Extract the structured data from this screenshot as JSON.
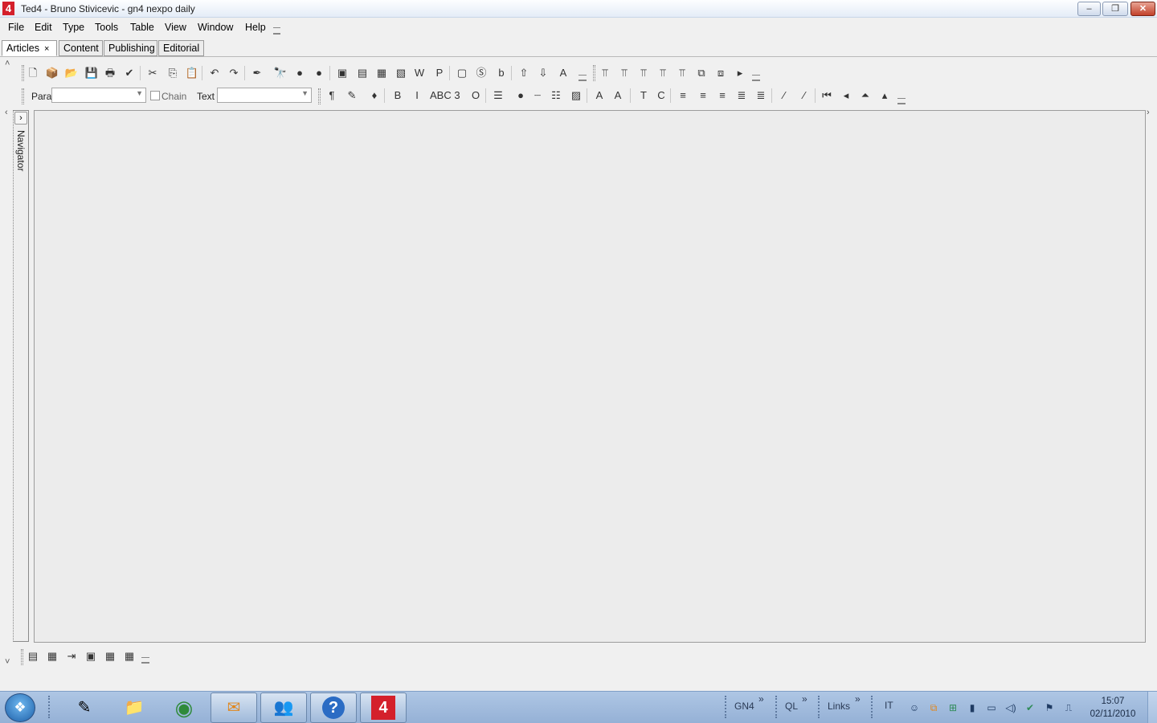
{
  "window": {
    "app_icon": "4",
    "title": "Ted4 - Bruno Stivicevic - gn4 nexpo daily",
    "minimize": "–",
    "restore": "❐",
    "close": "✕"
  },
  "menu": [
    "File",
    "Edit",
    "Type",
    "Tools",
    "Table",
    "View",
    "Window",
    "Help"
  ],
  "tabs": [
    {
      "label": "Articles",
      "closable": true,
      "close_glyph": "×"
    },
    {
      "label": "Content"
    },
    {
      "label": "Publishing"
    },
    {
      "label": "Editorial"
    }
  ],
  "toolbar_top": {
    "icons": [
      "new-icon",
      "package-icon",
      "open-icon",
      "save-icon",
      "print-icon",
      "spellcheck-icon",
      "cut-icon",
      "copy-icon",
      "paste-icon",
      "undo-icon",
      "redo-icon",
      "tools-icon",
      "find-icon",
      "globe-icon",
      "globe-refresh-icon",
      "frame-icon",
      "lock-frame-icon",
      "frames-icon",
      "frames-edit-icon",
      "word-icon",
      "p-icon",
      "folder-icon",
      "export-icon",
      "blog-icon",
      "link-up-icon",
      "link-down-icon",
      "text-format-icon"
    ],
    "glyphs": [
      "🗋",
      "📦",
      "📂",
      "💾",
      "🖶",
      "✔",
      "✂",
      "⎘",
      "📋",
      "↶",
      "↷",
      "✒",
      "🔭",
      "●",
      "●",
      "▣",
      "▤",
      "▦",
      "▧",
      "W",
      "P",
      "▢",
      "Ⓢ",
      "b",
      "⇧",
      "⇩",
      "A"
    ]
  },
  "toolbar_table": {
    "icons": [
      "table-row-above-icon",
      "table-row-below-icon",
      "table-col-left-icon",
      "table-col-right-icon",
      "table-delete-icon",
      "table-merge-icon",
      "table-split-icon",
      "more-arrow-icon"
    ],
    "glyphs": [
      "⫪",
      "⫪",
      "⫪",
      "⫪",
      "⫪",
      "⧉",
      "⧈",
      "▸"
    ]
  },
  "toolbar_format": {
    "para_label": "Para",
    "para_value": "",
    "chain_label": "Chain",
    "text_label": "Text",
    "text_value": "",
    "icons": [
      "pilcrow-icon",
      "brush-icon",
      "ink-icon",
      "bold-icon",
      "italic-icon",
      "strikethrough-icon",
      "number-icon",
      "circle-icon",
      "bullet-list-icon",
      "dot-icon",
      "line-icon",
      "numbered-list-icon",
      "doc-copy-icon",
      "font-grow-icon",
      "font-shrink-icon",
      "text-t-icon",
      "text-c-icon",
      "align-left-icon",
      "align-right-icon",
      "align-center-icon",
      "align-justify-icon",
      "justify-all-icon",
      "wand-icon",
      "wand2-icon",
      "first-icon",
      "prev-icon",
      "top-icon",
      "up-icon"
    ],
    "glyphs": [
      "¶",
      "✎",
      "♦",
      "B",
      "I",
      "ABC",
      "3",
      "O",
      "☰",
      "●",
      "┈",
      "☷",
      "▨",
      "A",
      "A",
      "T",
      "C",
      "≡",
      "≡",
      "≡",
      "≣",
      "≣",
      "⁄",
      "⁄",
      "⏮",
      "◂",
      "⏶",
      "▴"
    ]
  },
  "navigator": {
    "label": "Navigator",
    "toggle": "›"
  },
  "editor": {
    "content": ""
  },
  "bottom_toolbar": {
    "icons": [
      "view-list-icon",
      "view-table-icon",
      "indent-icon",
      "calendar-icon",
      "grid-icon",
      "table-icon"
    ],
    "glyphs": [
      "▤",
      "▦",
      "⇥",
      "▣",
      "▦",
      "▦"
    ]
  },
  "taskbar": {
    "start_glyph": "❖",
    "buttons": [
      {
        "name": "taskbar-notes",
        "glyph": "✎",
        "running": false
      },
      {
        "name": "taskbar-explorer",
        "glyph": "📁",
        "running": false
      },
      {
        "name": "taskbar-chrome",
        "glyph": "◉",
        "running": false
      },
      {
        "name": "taskbar-outlook",
        "glyph": "✉",
        "running": true
      },
      {
        "name": "taskbar-messenger",
        "glyph": "👥",
        "running": true
      },
      {
        "name": "taskbar-help",
        "glyph": "?",
        "running": true
      },
      {
        "name": "taskbar-ted4",
        "glyph": "4",
        "running": true
      }
    ],
    "toolbars": [
      "GN4",
      "QL",
      "Links"
    ],
    "chevron": "»",
    "language": "IT",
    "tray_icons": [
      "network-user-icon",
      "outlook-tray-icon",
      "windows-flag-icon",
      "signal-icon",
      "monitor-icon",
      "volume-icon",
      "security-icon",
      "flag-icon",
      "usb-icon"
    ],
    "tray_glyphs": [
      "☺",
      "⧉",
      "⊞",
      "▮",
      "▭",
      "◁)",
      "✔",
      "⚑",
      "⎍"
    ],
    "time": "15:07",
    "date": "02/11/2010"
  }
}
